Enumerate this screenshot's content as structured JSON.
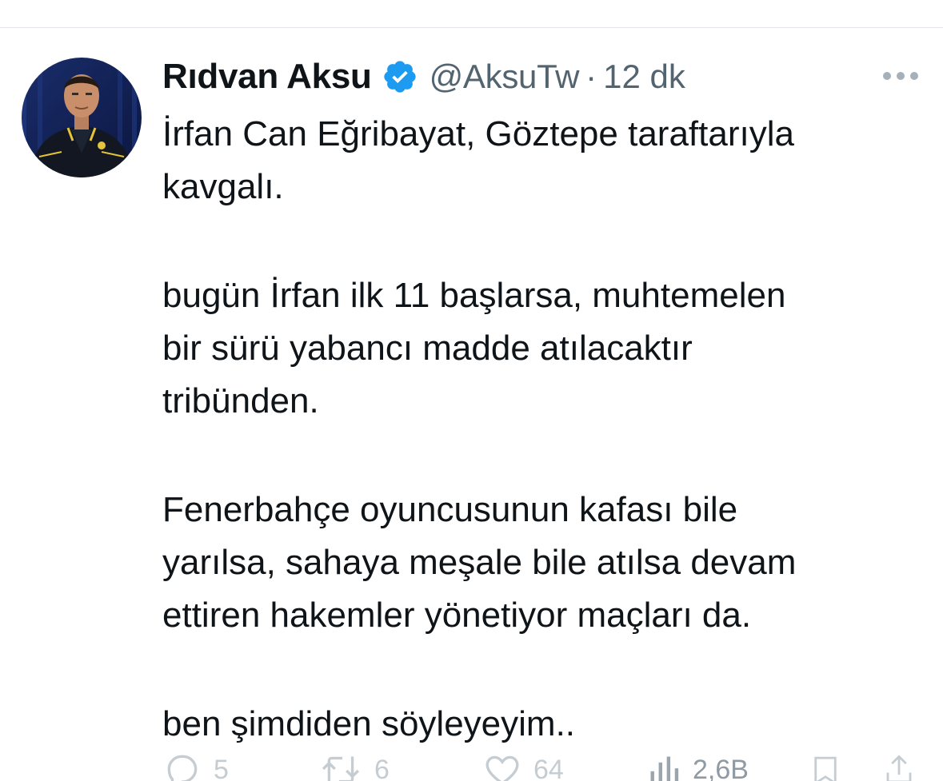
{
  "tweet": {
    "author_name": "Rıdvan Aksu",
    "handle": "@AksuTw",
    "separator": "·",
    "time": "12 dk",
    "paragraphs": [
      "İrfan Can Eğribayat, Göztepe taraftarıyla\nkavgalı.",
      "bugün İrfan ilk 11 başlarsa, muhtemelen\nbir sürü yabancı madde atılacaktır\ntribünden.",
      "Fenerbahçe oyuncusunun kafası bile\nyarılsa, sahaya meşale bile atılsa devam\nettiren hakemler yönetiyor maçları da.",
      "ben şimdiden söyleyeyim.."
    ]
  },
  "actions": {
    "replies": "5",
    "retweets": "6",
    "likes": "64",
    "views": "2,6B"
  },
  "icons": {
    "verified": "verified-badge-icon",
    "more": "more-horizontal-icon",
    "reply": "reply-icon",
    "retweet": "retweet-icon",
    "like": "heart-icon",
    "views": "views-chart-icon",
    "bookmark": "bookmark-icon",
    "share": "share-icon"
  },
  "colors": {
    "verified_blue": "#1d9bf0",
    "text_primary": "#0f1419",
    "text_secondary": "#536471"
  }
}
